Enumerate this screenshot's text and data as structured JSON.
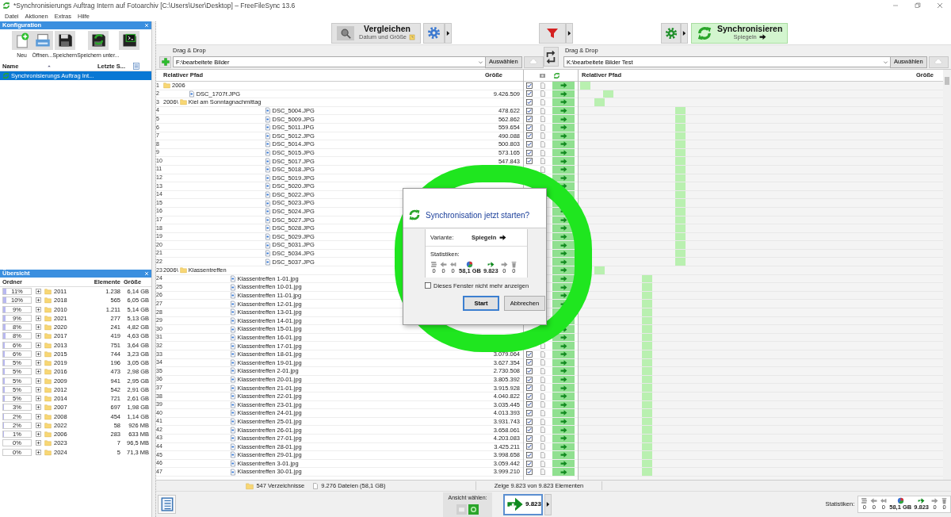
{
  "window": {
    "title": "*Synchronisierungs Auftrag Intern auf Fotoarchiv [C:\\Users\\User\\Desktop] – FreeFileSync 13.6"
  },
  "menu": [
    {
      "label": "Datei"
    },
    {
      "label": "Aktionen"
    },
    {
      "label": "Extras"
    },
    {
      "label": "Hilfe"
    }
  ],
  "config_panel": {
    "title": "Konfiguration",
    "tools": [
      {
        "kind": "new",
        "label": "Neu"
      },
      {
        "kind": "open",
        "label": "Öffnen..."
      },
      {
        "kind": "save",
        "label": "Speichern"
      },
      {
        "kind": "save_as",
        "label": "Speichern unter..."
      },
      {
        "kind": "batch"
      }
    ],
    "columns": [
      {
        "label": "Name",
        "sorted": true
      },
      {
        "label": "Letzte S..."
      }
    ],
    "items": [
      {
        "label": "Synchronisierungs Auftrag Int...",
        "selected": true
      }
    ]
  },
  "overview_panel": {
    "title": "Übersicht",
    "columns": [
      "Ordner",
      "Elemente",
      "Größe"
    ],
    "rows": [
      {
        "percent": "11%",
        "level": 0.11,
        "name": "2011",
        "count": "1.238",
        "size": "6,14 GB"
      },
      {
        "percent": "10%",
        "level": 0.1,
        "name": "2018",
        "count": "565",
        "size": "6,05 GB"
      },
      {
        "percent": "9%",
        "level": 0.09,
        "name": "2010",
        "count": "1.211",
        "size": "5,14 GB"
      },
      {
        "percent": "9%",
        "level": 0.09,
        "name": "2021",
        "count": "277",
        "size": "5,13 GB"
      },
      {
        "percent": "8%",
        "level": 0.08,
        "name": "2020",
        "count": "241",
        "size": "4,82 GB"
      },
      {
        "percent": "8%",
        "level": 0.08,
        "name": "2017",
        "count": "419",
        "size": "4,63 GB"
      },
      {
        "percent": "6%",
        "level": 0.06,
        "name": "2013",
        "count": "751",
        "size": "3,64 GB"
      },
      {
        "percent": "6%",
        "level": 0.06,
        "name": "2015",
        "count": "744",
        "size": "3,23 GB"
      },
      {
        "percent": "5%",
        "level": 0.05,
        "name": "2019",
        "count": "196",
        "size": "3,05 GB"
      },
      {
        "percent": "5%",
        "level": 0.05,
        "name": "2016",
        "count": "473",
        "size": "2,98 GB"
      },
      {
        "percent": "5%",
        "level": 0.05,
        "name": "2009",
        "count": "941",
        "size": "2,95 GB"
      },
      {
        "percent": "5%",
        "level": 0.05,
        "name": "2012",
        "count": "542",
        "size": "2,91 GB"
      },
      {
        "percent": "5%",
        "level": 0.05,
        "name": "2014",
        "count": "721",
        "size": "2,61 GB"
      },
      {
        "percent": "3%",
        "level": 0.03,
        "name": "2007",
        "count": "697",
        "size": "1,98 GB"
      },
      {
        "percent": "2%",
        "level": 0.02,
        "name": "2008",
        "count": "454",
        "size": "1,14 GB"
      },
      {
        "percent": "2%",
        "level": 0.02,
        "name": "2022",
        "count": "58",
        "size": "926 MB"
      },
      {
        "percent": "1%",
        "level": 0.01,
        "name": "2006",
        "count": "283",
        "size": "633 MB"
      },
      {
        "percent": "0%",
        "level": 0,
        "name": "2023",
        "count": "7",
        "size": "96,5 MB"
      },
      {
        "percent": "0%",
        "level": 0,
        "name": "2024",
        "count": "5",
        "size": "71,3 MB"
      }
    ]
  },
  "toolbar": {
    "compare": {
      "label": "Vergleichen",
      "variant": "Datum und Größe"
    },
    "sync": {
      "label": "Synchronisieren",
      "variant": "Spiegeln"
    }
  },
  "folder_pairs": [
    {
      "label": "Drag & Drop",
      "path": "F:\\bearbeitete Bilder",
      "button": "Auswählen"
    },
    {
      "label": "Drag & Drop",
      "path": "K:\\bearbeitete Bilder Test",
      "button": "Auswählen"
    }
  ],
  "grid": {
    "left_columns": [
      "Relativer Pfad",
      "Größe"
    ],
    "right_columns": [
      "Relativer Pfad",
      "Größe"
    ],
    "rows": [
      {
        "number": "1",
        "kind": "folder",
        "name": "2006",
        "checked": true,
        "children": [
          {
            "number": "2",
            "kind": "file",
            "name": "DSC_1707f.JPG",
            "size": "9.426.509",
            "checked": true
          }
        ]
      },
      {
        "number": "3",
        "kind": "folder",
        "prefix": "2006\\",
        "name": "Kiel am Sonntagnachmittag",
        "checked": true,
        "children": [
          {
            "number": "4",
            "kind": "file",
            "name": "DSC_5004.JPG",
            "size": "478.622",
            "checked": true
          },
          {
            "number": "5",
            "kind": "file",
            "name": "DSC_5009.JPG",
            "size": "562.862",
            "checked": true
          },
          {
            "number": "6",
            "kind": "file",
            "name": "DSC_5011.JPG",
            "size": "559.654",
            "checked": true
          },
          {
            "number": "7",
            "kind": "file",
            "name": "DSC_5012.JPG",
            "size": "490.088",
            "checked": true
          },
          {
            "number": "8",
            "kind": "file",
            "name": "DSC_5014.JPG",
            "size": "500.803",
            "checked": true
          },
          {
            "number": "9",
            "kind": "file",
            "name": "DSC_5015.JPG",
            "size": "573.165",
            "checked": true
          },
          {
            "number": "10",
            "kind": "file",
            "name": "DSC_5017.JPG",
            "size": "547.843",
            "checked": true
          },
          {
            "number": "11",
            "kind": "file",
            "name": "DSC_5018.JPG"
          },
          {
            "number": "12",
            "kind": "file",
            "name": "DSC_5019.JPG"
          },
          {
            "number": "13",
            "kind": "file",
            "name": "DSC_5020.JPG"
          },
          {
            "number": "14",
            "kind": "file",
            "name": "DSC_5022.JPG"
          },
          {
            "number": "15",
            "kind": "file",
            "name": "DSC_5023.JPG"
          },
          {
            "number": "16",
            "kind": "file",
            "name": "DSC_5024.JPG"
          },
          {
            "number": "17",
            "kind": "file",
            "name": "DSC_5027.JPG"
          },
          {
            "number": "18",
            "kind": "file",
            "name": "DSC_5028.JPG"
          },
          {
            "number": "19",
            "kind": "file",
            "name": "DSC_5029.JPG"
          },
          {
            "number": "20",
            "kind": "file",
            "name": "DSC_5031.JPG"
          },
          {
            "number": "21",
            "kind": "file",
            "name": "DSC_5034.JPG"
          },
          {
            "number": "22",
            "kind": "file",
            "name": "DSC_5037.JPG"
          }
        ]
      },
      {
        "number": "23",
        "kind": "folder",
        "prefix": "2006\\",
        "name": "Klassentreffen",
        "children": [
          {
            "number": "24",
            "kind": "file",
            "name": "Klassentreffen 1-01.jpg"
          },
          {
            "number": "25",
            "kind": "file",
            "name": "Klassentreffen 10-01.jpg"
          },
          {
            "number": "26",
            "kind": "file",
            "name": "Klassentreffen 11-01.jpg"
          },
          {
            "number": "27",
            "kind": "file",
            "name": "Klassentreffen 12-01.jpg"
          },
          {
            "number": "28",
            "kind": "file",
            "name": "Klassentreffen 13-01.jpg"
          },
          {
            "number": "29",
            "kind": "file",
            "name": "Klassentreffen 14-01.jpg"
          },
          {
            "number": "30",
            "kind": "file",
            "name": "Klassentreffen 15-01.jpg"
          },
          {
            "number": "31",
            "kind": "file",
            "name": "Klassentreffen 16-01.jpg"
          },
          {
            "number": "32",
            "kind": "file",
            "name": "Klassentreffen 17-01.jpg"
          },
          {
            "number": "33",
            "kind": "file",
            "name": "Klassentreffen 18-01.jpg",
            "size": "3.079.064",
            "checked": true
          },
          {
            "number": "34",
            "kind": "file",
            "name": "Klassentreffen 19-01.jpg",
            "size": "3.627.354",
            "checked": true
          },
          {
            "number": "35",
            "kind": "file",
            "name": "Klassentreffen 2-01.jpg",
            "size": "2.730.508",
            "checked": true
          },
          {
            "number": "36",
            "kind": "file",
            "name": "Klassentreffen 20-01.jpg",
            "size": "3.805.392",
            "checked": true
          },
          {
            "number": "37",
            "kind": "file",
            "name": "Klassentreffen 21-01.jpg",
            "size": "3.915.928",
            "checked": true
          },
          {
            "number": "38",
            "kind": "file",
            "name": "Klassentreffen 22-01.jpg",
            "size": "4.040.822",
            "checked": true
          },
          {
            "number": "39",
            "kind": "file",
            "name": "Klassentreffen 23-01.jpg",
            "size": "3.035.445",
            "checked": true
          },
          {
            "number": "40",
            "kind": "file",
            "name": "Klassentreffen 24-01.jpg",
            "size": "4.013.393",
            "checked": true
          },
          {
            "number": "41",
            "kind": "file",
            "name": "Klassentreffen 25-01.jpg",
            "size": "3.931.743",
            "checked": true
          },
          {
            "number": "42",
            "kind": "file",
            "name": "Klassentreffen 26-01.jpg",
            "size": "3.658.061",
            "checked": true
          },
          {
            "number": "43",
            "kind": "file",
            "name": "Klassentreffen 27-01.jpg",
            "size": "4.203.083",
            "checked": true
          },
          {
            "number": "44",
            "kind": "file",
            "name": "Klassentreffen 28-01.jpg",
            "size": "3.425.211",
            "checked": true
          },
          {
            "number": "45",
            "kind": "file",
            "name": "Klassentreffen 29-01.jpg",
            "size": "3.998.658",
            "checked": true
          },
          {
            "number": "46",
            "kind": "file",
            "name": "Klassentreffen 3-01.jpg",
            "size": "3.059.442",
            "checked": true
          },
          {
            "number": "47",
            "kind": "file",
            "name": "Klassentreffen 30-01.jpg",
            "size": "3.999.210",
            "checked": true
          }
        ]
      }
    ]
  },
  "status": {
    "items": [
      {
        "kind": "folders",
        "text": "547 Verzeichnisse"
      },
      {
        "kind": "files",
        "text": "9.276 Dateien (58,1 GB)"
      }
    ],
    "summary": "Zeige 9.823 von 9.823 Elementen"
  },
  "bottom_bar": {
    "view_label": "Ansicht wählen:",
    "views": [
      {
        "kind": "compare",
        "selected": false
      },
      {
        "kind": "action",
        "selected": true
      }
    ],
    "sync_count": "9.823",
    "stats_label": "Statistiken:",
    "stats": [
      {
        "kind": "create_left",
        "value": "0",
        "active": false
      },
      {
        "kind": "update_left",
        "value": "0",
        "active": false
      },
      {
        "kind": "delete_left",
        "value": "0",
        "active": false
      },
      {
        "kind": "data",
        "value": "58,1 GB",
        "active": true
      },
      {
        "kind": "create_right",
        "value": "9.823",
        "active": true
      },
      {
        "kind": "update_right",
        "value": "0",
        "active": false
      },
      {
        "kind": "delete_right",
        "value": "0",
        "active": false
      }
    ]
  },
  "dialog": {
    "title": "Synchronisation jetzt starten?",
    "variant_label": "Variante:",
    "variant": "Spiegeln",
    "stats_label": "Statistiken:",
    "stats": [
      {
        "kind": "create_left",
        "value": "0",
        "active": false
      },
      {
        "kind": "update_left",
        "value": "0",
        "active": false
      },
      {
        "kind": "delete_left",
        "value": "0",
        "active": false
      },
      {
        "kind": "data",
        "value": "58,1 GB",
        "active": true
      },
      {
        "kind": "create_right",
        "value": "9.823",
        "active": true
      },
      {
        "kind": "update_right",
        "value": "0",
        "active": false
      },
      {
        "kind": "delete_right",
        "value": "0",
        "active": false
      }
    ],
    "dont_show": {
      "label": "Dieses Fenster nicht mehr anzeigen",
      "checked": false
    },
    "buttons": [
      {
        "label": "Start",
        "default": true
      },
      {
        "label": "Abbrechen",
        "default": false
      }
    ]
  },
  "highlight": {
    "kind": "ring"
  }
}
